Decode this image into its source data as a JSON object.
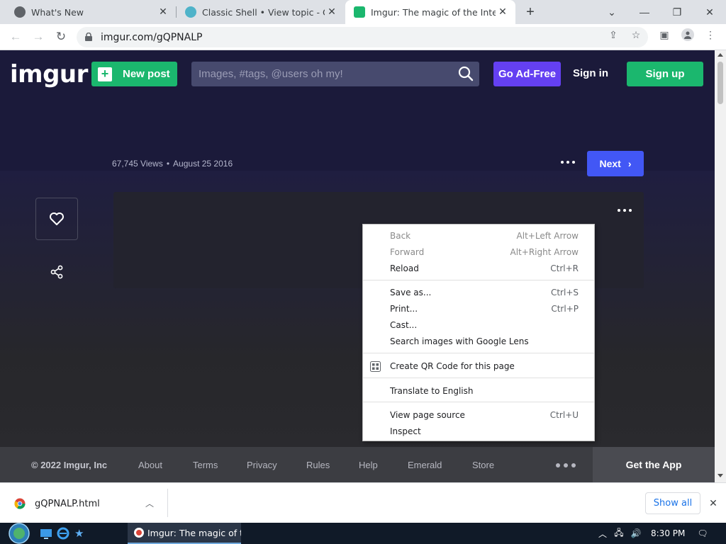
{
  "browser": {
    "tabs": [
      {
        "title": "What's New",
        "active": false
      },
      {
        "title": "Classic Shell • View topic - Origin",
        "active": false
      },
      {
        "title": "Imgur: The magic of the Internet",
        "active": true
      }
    ],
    "url": "imgur.com/gQPNALP"
  },
  "header": {
    "logo": "imgur",
    "new_post": "New post",
    "search_placeholder": "Images, #tags, @users oh my!",
    "ad_free": "Go Ad-Free",
    "sign_in": "Sign in",
    "sign_up": "Sign up"
  },
  "post": {
    "views": "67,745 Views",
    "separator": "•",
    "date": "August 25 2016",
    "next": "Next"
  },
  "footer": {
    "copyright": "© 2022 Imgur, Inc",
    "links": [
      "About",
      "Terms",
      "Privacy",
      "Rules",
      "Help",
      "Emerald",
      "Store"
    ],
    "get_app": "Get the App"
  },
  "context_menu": {
    "groups": [
      [
        {
          "label": "Back",
          "shortcut": "Alt+Left Arrow",
          "disabled": true
        },
        {
          "label": "Forward",
          "shortcut": "Alt+Right Arrow",
          "disabled": true
        },
        {
          "label": "Reload",
          "shortcut": "Ctrl+R",
          "disabled": false
        }
      ],
      [
        {
          "label": "Save as...",
          "shortcut": "Ctrl+S",
          "disabled": false
        },
        {
          "label": "Print...",
          "shortcut": "Ctrl+P",
          "disabled": false
        },
        {
          "label": "Cast...",
          "shortcut": "",
          "disabled": false
        },
        {
          "label": "Search images with Google Lens",
          "shortcut": "",
          "disabled": false
        }
      ],
      [
        {
          "label": "Create QR Code for this page",
          "shortcut": "",
          "disabled": false,
          "icon": "qr-code-icon"
        }
      ],
      [
        {
          "label": "Translate to English",
          "shortcut": "",
          "disabled": false
        }
      ],
      [
        {
          "label": "View page source",
          "shortcut": "Ctrl+U",
          "disabled": false
        },
        {
          "label": "Inspect",
          "shortcut": "",
          "disabled": false
        }
      ]
    ]
  },
  "download_bar": {
    "file_name": "gQPNALP.html",
    "show_all": "Show all"
  },
  "taskbar": {
    "app_title": "Imgur: The magic of t...",
    "time": "8:30 PM"
  },
  "colors": {
    "imgur_green": "#1bb76e",
    "ad_free_purple": "#6440f2",
    "next_blue": "#4257f5",
    "page_bg": "#1b1a3a"
  }
}
